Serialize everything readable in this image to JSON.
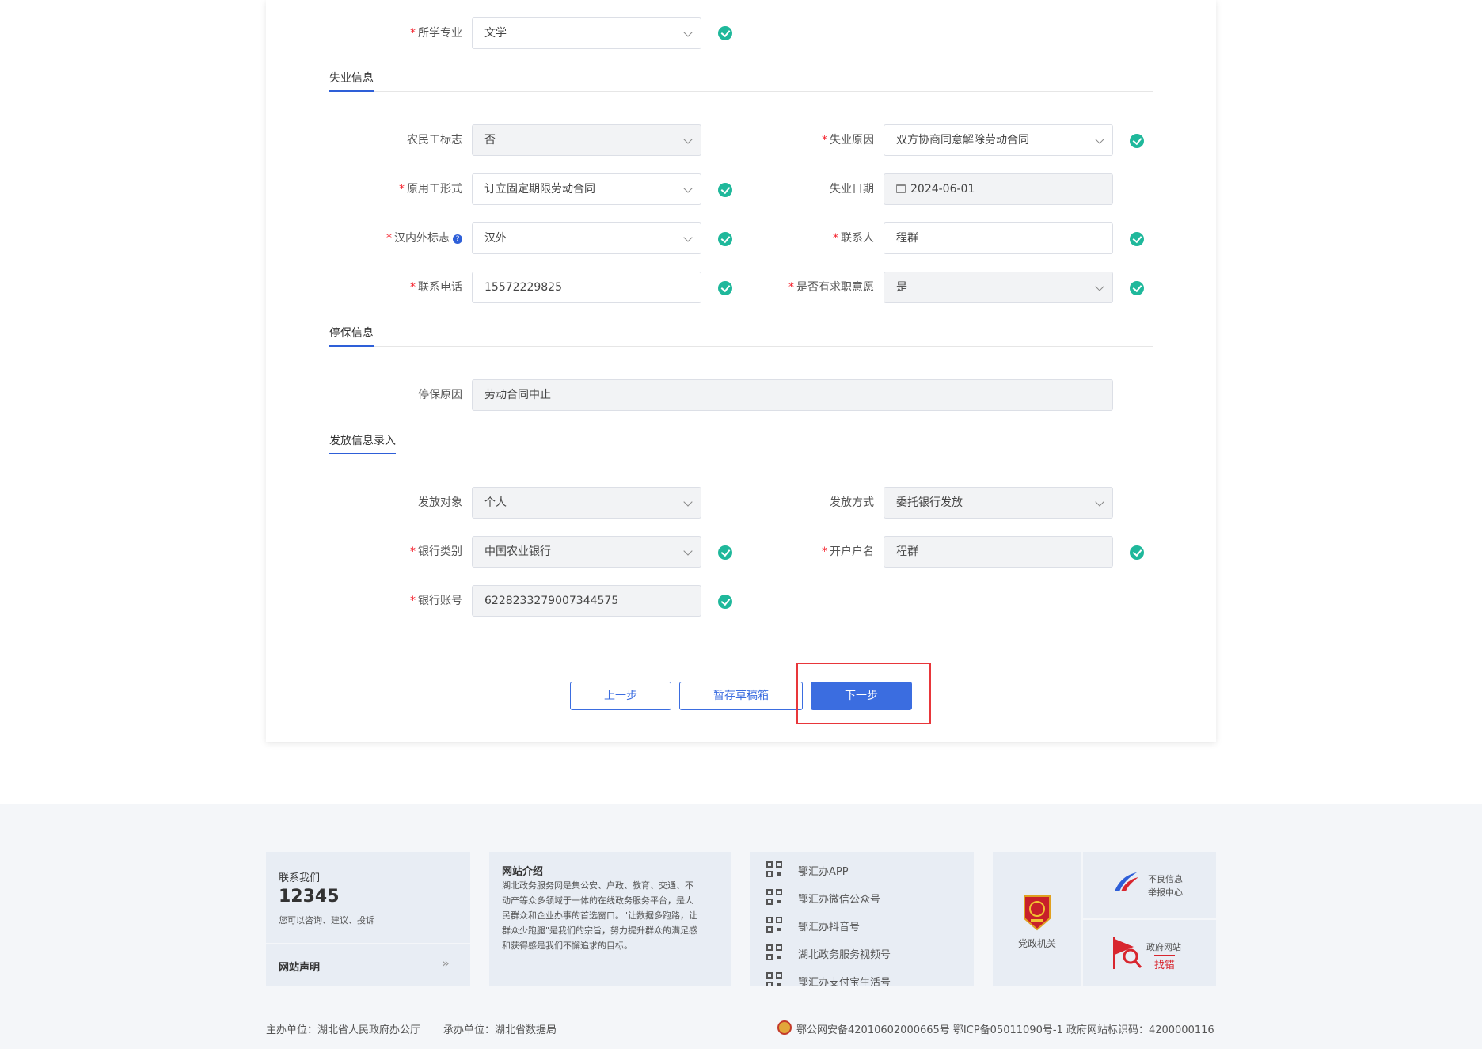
{
  "colors": {
    "accent": "#3b6de0",
    "success": "#1fb89b",
    "required": "#f5222d",
    "highlight": "#e8363a"
  },
  "form": {
    "major": {
      "label": "所学专业",
      "value": "文学"
    },
    "sections": {
      "unemployment": "失业信息",
      "insurance_stop": "停保信息",
      "payment": "发放信息录入"
    },
    "migrant_flag": {
      "label": "农民工标志",
      "value": "否"
    },
    "unemploy_reason": {
      "label": "失业原因",
      "value": "双方协商同意解除劳动合同"
    },
    "employment_form": {
      "label": "原用工形式",
      "value": "订立固定期限劳动合同"
    },
    "unemploy_date": {
      "label": "失业日期",
      "value": "2024-06-01"
    },
    "han_flag": {
      "label": "汉内外标志",
      "value": "汉外",
      "help": "?"
    },
    "contact_person": {
      "label": "联系人",
      "value": "程群"
    },
    "phone": {
      "label": "联系电话",
      "value": "15572229825"
    },
    "job_intent": {
      "label": "是否有求职意愿",
      "value": "是"
    },
    "stop_reason": {
      "label": "停保原因",
      "value": "劳动合同中止"
    },
    "pay_target": {
      "label": "发放对象",
      "value": "个人"
    },
    "pay_method": {
      "label": "发放方式",
      "value": "委托银行发放"
    },
    "bank_type": {
      "label": "银行类别",
      "value": "中国农业银行"
    },
    "account_name": {
      "label": "开户户名",
      "value": "程群"
    },
    "bank_account": {
      "label": "银行账号",
      "value": "6228233279007344575"
    },
    "buttons": {
      "prev": "上一步",
      "draft": "暂存草稿箱",
      "next": "下一步"
    }
  },
  "footer": {
    "contact": {
      "title": "联系我们",
      "phone": "12345",
      "desc": "您可以咨询、建议、投诉"
    },
    "statement": {
      "label": "网站声明",
      "arrow": "»"
    },
    "intro": {
      "title": "网站介绍",
      "lines": [
        "湖北政务服务网是集公安、户政、教育、交通、不",
        "动产等众多领域于一体的在线政务服务平台，是人",
        "民群众和企业办事的首选窗口。\"让数据多跑路，让",
        "群众少跑腿\"是我们的宗旨，努力提升群众的满足感",
        "和获得感是我们不懈追求的目标。"
      ]
    },
    "channels": [
      "鄂汇办APP",
      "鄂汇办微信公众号",
      "鄂汇办抖音号",
      "湖北政务服务视频号",
      "鄂汇办支付宝生活号"
    ],
    "party_org": "党政机关",
    "report": {
      "line1": "不良信息",
      "line2": "举报中心"
    },
    "gov_error": {
      "line1": "政府网站",
      "line2": "找错"
    },
    "sponsor": "主办单位：湖北省人民政府办公厅",
    "organizer": "承办单位：湖北省数据局",
    "record": "鄂公网安备42010602000665号 鄂ICP备05011090号-1 政府网站标识码：4200000116"
  }
}
